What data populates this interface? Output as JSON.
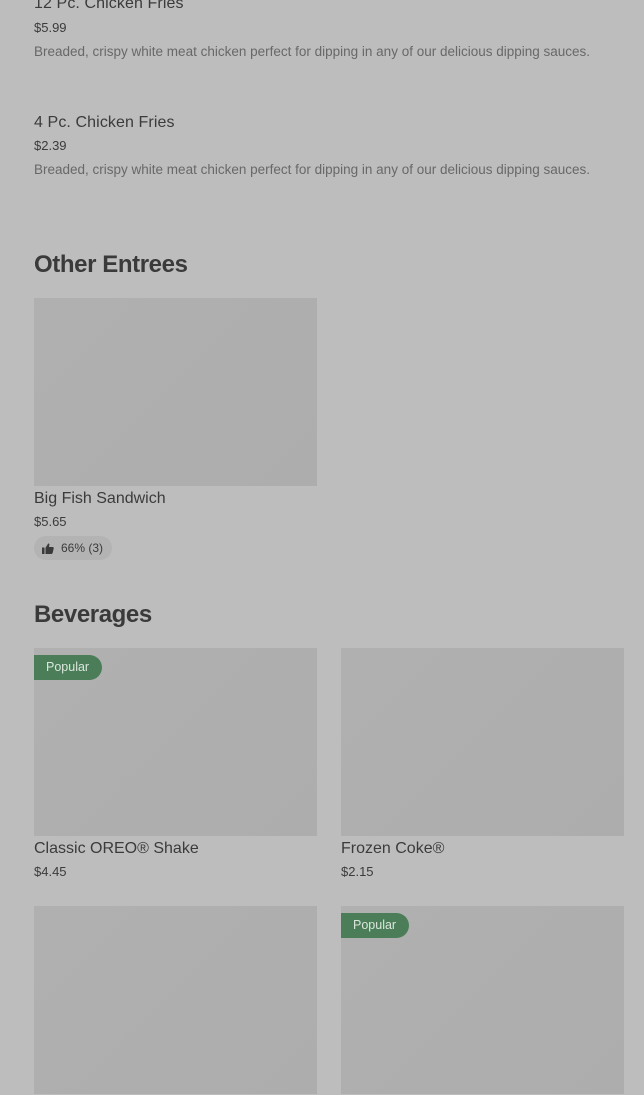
{
  "items": [
    {
      "name": "12 Pc. Chicken Fries",
      "price": "$5.99",
      "description": "Breaded, crispy white meat chicken perfect for dipping in any of our delicious dipping sauces."
    },
    {
      "name": "4 Pc. Chicken Fries",
      "price": "$2.39",
      "description": "Breaded, crispy white meat chicken perfect for dipping in any of our delicious dipping sauces."
    }
  ],
  "sections": {
    "other_entrees": {
      "title": "Other Entrees",
      "cards": [
        {
          "name": "Big Fish Sandwich",
          "price": "$5.65",
          "rating": "66% (3)",
          "rating_icon": "thumbs-up-icon"
        }
      ]
    },
    "beverages": {
      "title": "Beverages",
      "cards": [
        {
          "name": "Classic OREO® Shake",
          "price": "$4.45",
          "badge": "Popular"
        },
        {
          "name": "Frozen Coke®",
          "price": "$2.15",
          "badge": ""
        },
        {
          "name": "",
          "price": "",
          "badge": ""
        },
        {
          "name": "",
          "price": "",
          "badge": "Popular"
        }
      ]
    }
  },
  "colors": {
    "background": "#bdbdbd",
    "badge": "#4c7d59",
    "image_placeholder": "#afafaf"
  }
}
